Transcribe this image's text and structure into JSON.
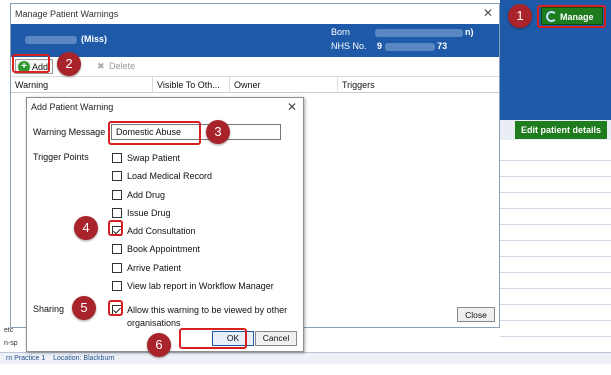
{
  "main_window": {
    "title": "Manage Patient Warnings",
    "patient_title": "(Miss)",
    "born_label": "Born",
    "born_suffix": "n)",
    "nhs_label": "NHS No.",
    "nhs_partial": "9",
    "nhs_suffix": "73",
    "toolbar": {
      "add_label": "Add",
      "delete_label": "Delete"
    },
    "columns": [
      "Warning",
      "Visible To Oth...",
      "Owner",
      "Triggers"
    ],
    "close_label": "Close"
  },
  "background_app": {
    "manage_label": "Manage",
    "edit_patient_label": "Edit patient details",
    "left_fragments": [
      "etc",
      "n-sp"
    ],
    "status_text": "rn Practice 1    Location: Blackburn"
  },
  "dialog": {
    "title": "Add Patient Warning",
    "warning_message_label": "Warning Message",
    "warning_message_value": "Domestic Abuse",
    "trigger_points_label": "Trigger Points",
    "triggers": [
      {
        "label": "Swap Patient",
        "checked": false
      },
      {
        "label": "Load Medical Record",
        "checked": false
      },
      {
        "label": "Add Drug",
        "checked": false
      },
      {
        "label": "Issue Drug",
        "checked": false
      },
      {
        "label": "Add Consultation",
        "checked": true
      },
      {
        "label": "Book Appointment",
        "checked": false
      },
      {
        "label": "Arrive Patient",
        "checked": false
      },
      {
        "label": "View lab report in Workflow Manager",
        "checked": false
      }
    ],
    "sharing_label": "Sharing",
    "sharing_text": "Allow this warning to be viewed by other organisations",
    "sharing_checked": true,
    "ok_label": "OK",
    "cancel_label": "Cancel"
  },
  "callouts": [
    "1",
    "2",
    "3",
    "4",
    "5",
    "6"
  ],
  "colors": {
    "accent": "#1f5aa8",
    "green_button": "#1e7b1e",
    "callout_red": "#a8232a",
    "highlight": "#d82020"
  }
}
